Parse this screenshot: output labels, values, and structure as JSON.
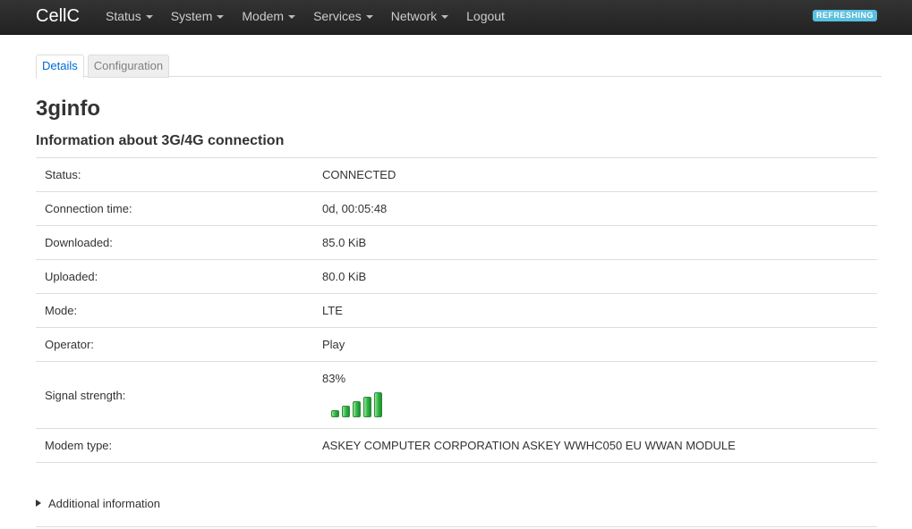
{
  "navbar": {
    "brand": "CellC",
    "items": [
      {
        "label": "Status",
        "dropdown": true
      },
      {
        "label": "System",
        "dropdown": true
      },
      {
        "label": "Modem",
        "dropdown": true
      },
      {
        "label": "Services",
        "dropdown": true
      },
      {
        "label": "Network",
        "dropdown": true
      },
      {
        "label": "Logout",
        "dropdown": false
      }
    ],
    "badge": "REFRESHING",
    "badge_color": "#5bc0de"
  },
  "tabs": [
    {
      "label": "Details",
      "active": true
    },
    {
      "label": "Configuration",
      "active": false
    }
  ],
  "page": {
    "title": "3ginfo",
    "subtitle": "Information about 3G/4G connection"
  },
  "info": {
    "rows": [
      {
        "label": "Status:",
        "value": "CONNECTED"
      },
      {
        "label": "Connection time:",
        "value": "0d, 00:05:48"
      },
      {
        "label": "Downloaded:",
        "value": "85.0 KiB"
      },
      {
        "label": "Uploaded:",
        "value": "80.0 KiB"
      },
      {
        "label": "Mode:",
        "value": "LTE"
      },
      {
        "label": "Operator:",
        "value": "Play"
      }
    ],
    "signal": {
      "label": "Signal strength:",
      "value": "83%",
      "bars_filled": 5,
      "bars_total": 5,
      "icon": "signal-bars-icon"
    },
    "modem": {
      "label": "Modem type:",
      "value": "ASKEY COMPUTER CORPORATION ASKEY WWHC050 EU WWAN MODULE"
    }
  },
  "additional": {
    "label": "Additional information",
    "icon": "expand-triangle-icon"
  }
}
